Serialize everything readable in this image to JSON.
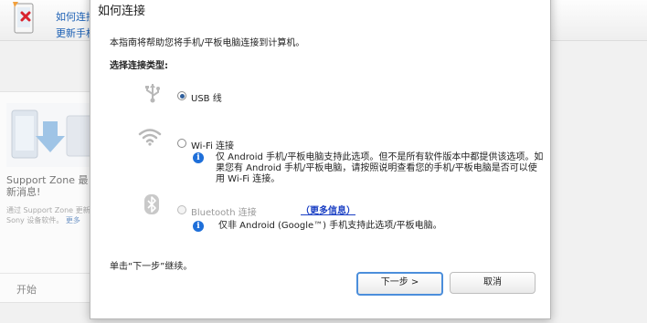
{
  "background": {
    "header_links": [
      "如何连接",
      "更新手机"
    ],
    "panel": {
      "title": "Support Zone 最新消息!",
      "description": "通过 Support Zone 更新 Sony 设备软件。",
      "more_link": "更多",
      "start_label": "开始"
    }
  },
  "dialog": {
    "title": "如何连接",
    "intro": "本指南将帮助您将手机/平板电脑连接到计算机。",
    "section_heading": "选择连接类型:",
    "options": [
      {
        "icon": "usb-icon",
        "label": "USB 线",
        "selected": true,
        "enabled": true
      },
      {
        "icon": "wifi-icon",
        "label": "Wi-Fi 连接",
        "selected": false,
        "enabled": true,
        "info": "仅 Android 手机/平板电脑支持此选项。但不是所有软件版本中都提供该选项。如果您有 Android 手机/平板电脑，请按照说明查看您的手机/平板电脑是否可以使用 Wi-Fi 连接。"
      },
      {
        "icon": "bluetooth-icon",
        "label": "Bluetooth 连接",
        "selected": false,
        "enabled": false,
        "more_info": "（更多信息）",
        "info": "仅非 Android (Google™) 手机支持此选项/平板电脑。"
      }
    ],
    "footer_text": "单击“下一步”继续。",
    "next_button": "下一步 >",
    "cancel_button": "取消"
  }
}
